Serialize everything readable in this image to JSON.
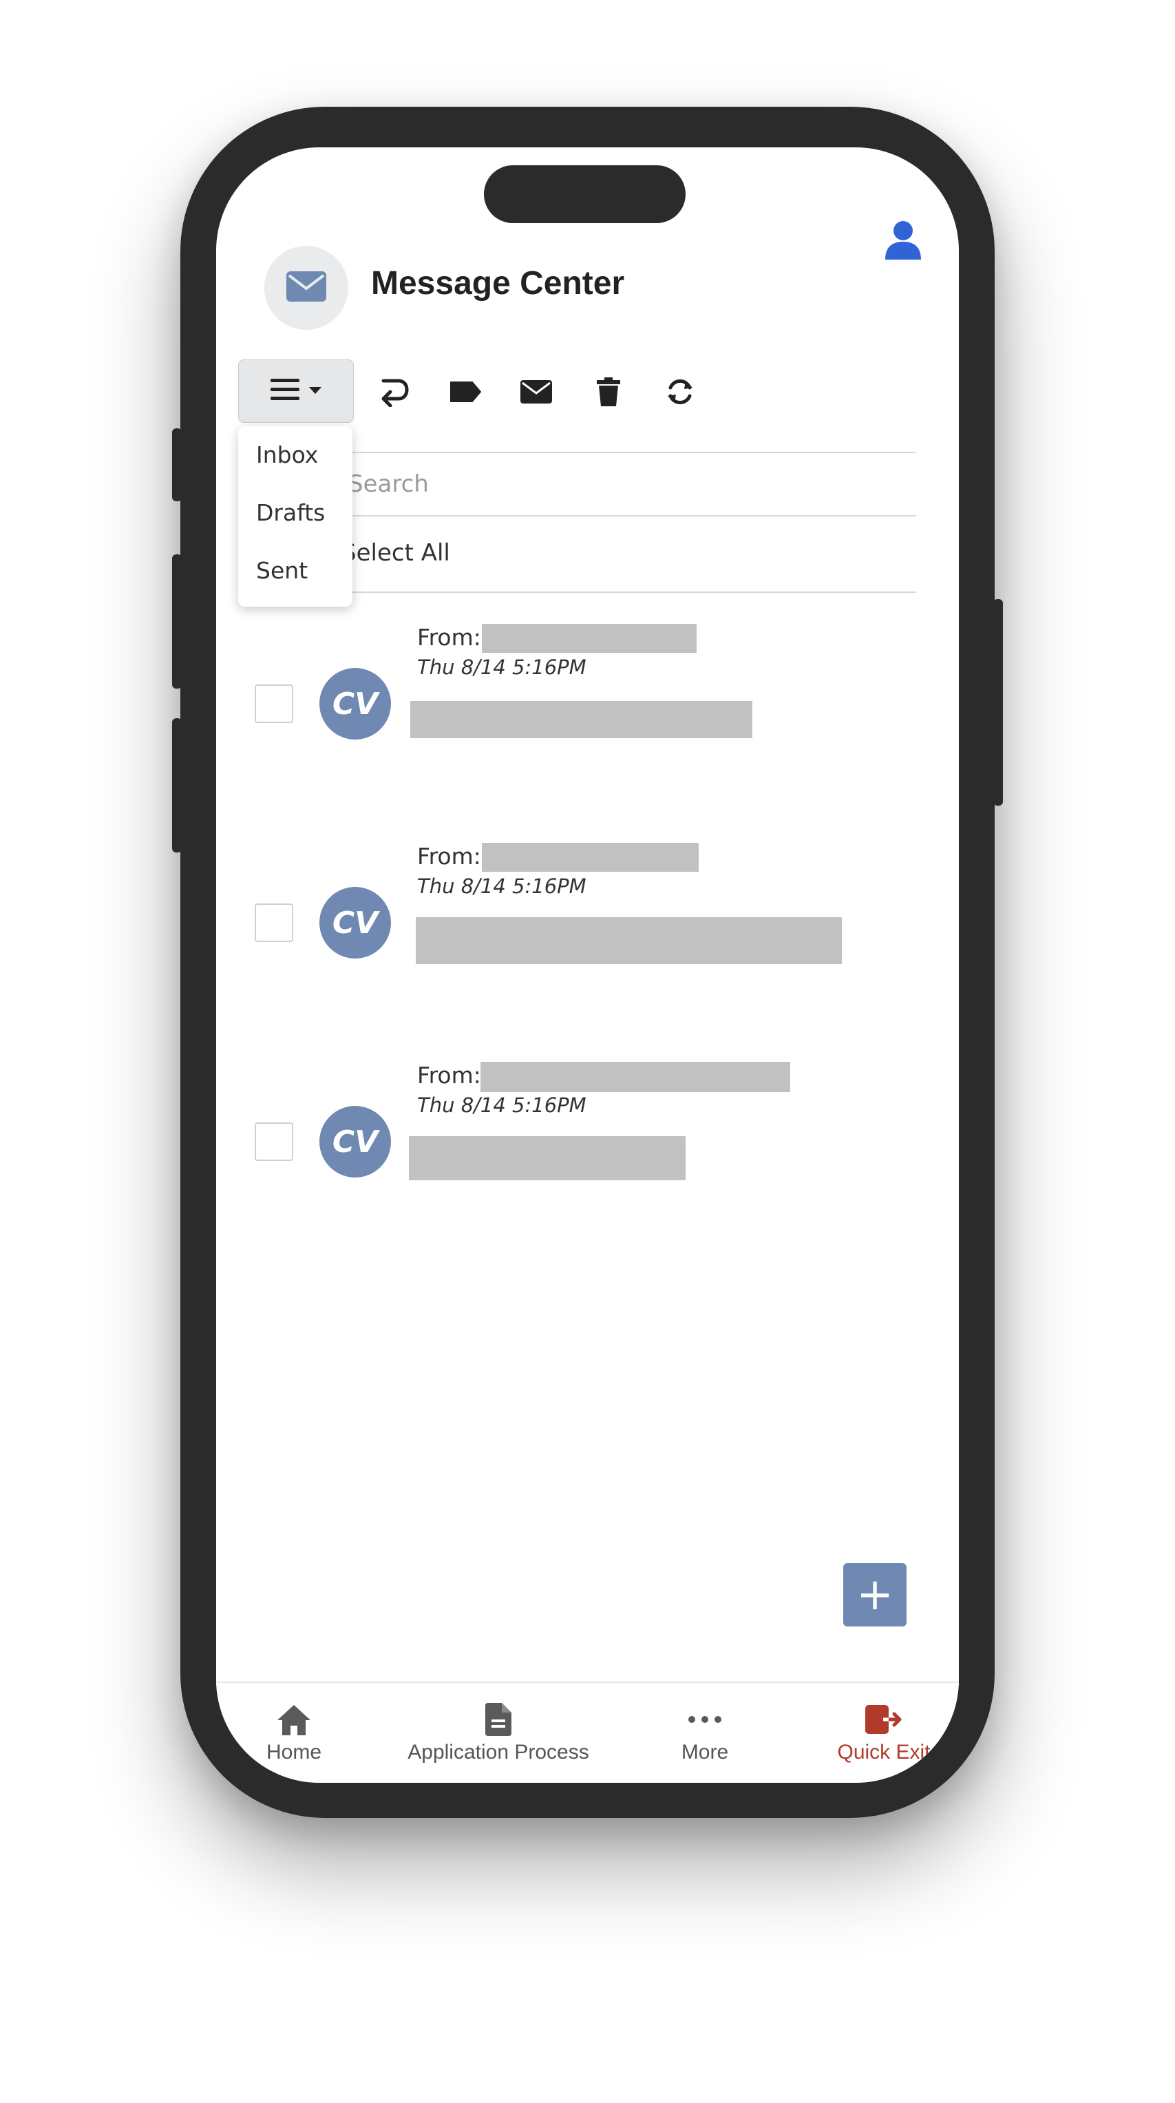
{
  "app": {
    "title": "Message Center"
  },
  "toolbar": {
    "menu_icon": "hamburger-dropdown-icon",
    "actions": [
      "reply-icon",
      "tag-icon",
      "envelope-icon",
      "trash-icon",
      "refresh-icon"
    ]
  },
  "dropdown": {
    "items": [
      "Inbox",
      "Drafts",
      "Sent"
    ]
  },
  "search": {
    "placeholder": "Search"
  },
  "select_all": {
    "label": "Select All"
  },
  "messages": [
    {
      "initials": "CV",
      "from_label": "From:",
      "date": "Thu 8/14 5:16PM"
    },
    {
      "initials": "CV",
      "from_label": "From:",
      "date": "Thu 8/14 5:16PM"
    },
    {
      "initials": "CV",
      "from_label": "From:",
      "date": "Thu 8/14 5:16PM"
    }
  ],
  "fab": {
    "label": "+"
  },
  "bottom_nav": {
    "items": [
      {
        "label": "Home",
        "icon": "home-icon"
      },
      {
        "label": "Application Process",
        "icon": "document-icon"
      },
      {
        "label": "More",
        "icon": "more-icon"
      },
      {
        "label": "Quick Exit",
        "icon": "exit-icon"
      }
    ]
  },
  "colors": {
    "accent": "#6f89b2",
    "profile": "#2f63d6",
    "exit": "#b23a2a"
  }
}
